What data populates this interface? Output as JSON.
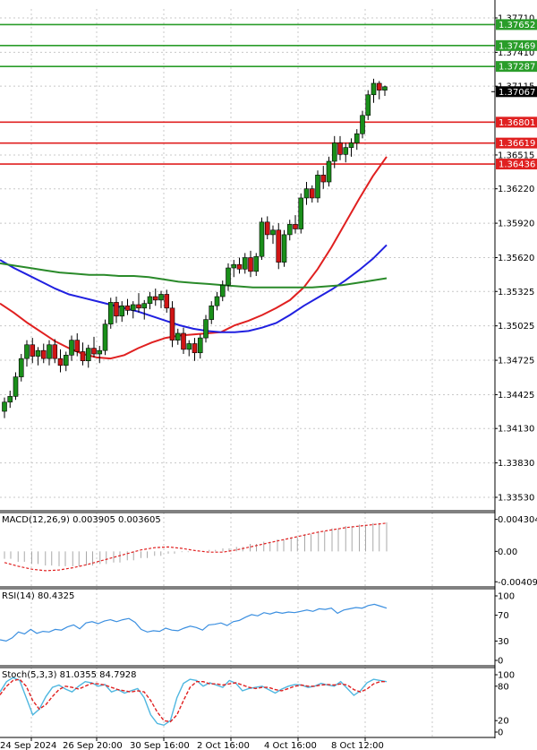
{
  "chart_data": [
    {
      "panel": "price",
      "type": "candlestick",
      "y_ticks": [
        "1.37710",
        "1.37410",
        "1.37115",
        "1.36515",
        "1.36220",
        "1.35920",
        "1.35620",
        "1.35325",
        "1.35025",
        "1.34725",
        "1.34425",
        "1.34130",
        "1.33830",
        "1.33530"
      ],
      "ylim": [
        1.334,
        1.3775
      ],
      "current_price": {
        "value": 1.37067,
        "label": "1.37067"
      },
      "resistance_levels": [
        {
          "value": 1.37652,
          "label": "1.37652",
          "color": "#2a9d2a"
        },
        {
          "value": 1.37469,
          "label": "1.37469",
          "color": "#2a9d2a"
        },
        {
          "value": 1.37287,
          "label": "1.37287",
          "color": "#2a9d2a"
        }
      ],
      "support_levels": [
        {
          "value": 1.36801,
          "label": "1.36801",
          "color": "#e02020"
        },
        {
          "value": 1.36619,
          "label": "1.36619",
          "color": "#e02020"
        },
        {
          "value": 1.36436,
          "label": "1.36436",
          "color": "#e02020"
        }
      ],
      "candle_colors": {
        "up": "#1a8f1a",
        "down": "#d01515"
      },
      "candles": [
        [
          1.3428,
          1.344,
          1.3422,
          1.3436
        ],
        [
          1.3436,
          1.3446,
          1.3431,
          1.3441
        ],
        [
          1.3441,
          1.3462,
          1.3438,
          1.3458
        ],
        [
          1.3458,
          1.3478,
          1.3454,
          1.3474
        ],
        [
          1.3474,
          1.349,
          1.3467,
          1.3486
        ],
        [
          1.3486,
          1.3492,
          1.347,
          1.3476
        ],
        [
          1.3476,
          1.3484,
          1.3468,
          1.3481
        ],
        [
          1.3481,
          1.3487,
          1.347,
          1.3474
        ],
        [
          1.3474,
          1.349,
          1.3468,
          1.3486
        ],
        [
          1.3486,
          1.3491,
          1.347,
          1.3474
        ],
        [
          1.3474,
          1.3482,
          1.3462,
          1.3468
        ],
        [
          1.3468,
          1.348,
          1.3463,
          1.3477
        ],
        [
          1.3477,
          1.3494,
          1.3472,
          1.349
        ],
        [
          1.349,
          1.3496,
          1.3476,
          1.348
        ],
        [
          1.348,
          1.3488,
          1.3468,
          1.3472
        ],
        [
          1.3472,
          1.3486,
          1.3466,
          1.3483
        ],
        [
          1.3483,
          1.3493,
          1.3475,
          1.3478
        ],
        [
          1.3478,
          1.3485,
          1.347,
          1.3481
        ],
        [
          1.3481,
          1.3508,
          1.3477,
          1.3504
        ],
        [
          1.3504,
          1.3527,
          1.35,
          1.3523
        ],
        [
          1.3523,
          1.3528,
          1.3505,
          1.3511
        ],
        [
          1.3511,
          1.3524,
          1.3506,
          1.352
        ],
        [
          1.352,
          1.3526,
          1.3512,
          1.3516
        ],
        [
          1.3516,
          1.3524,
          1.3509,
          1.3521
        ],
        [
          1.3521,
          1.3531,
          1.3514,
          1.3518
        ],
        [
          1.3518,
          1.3525,
          1.3508,
          1.3522
        ],
        [
          1.3522,
          1.3532,
          1.3517,
          1.3528
        ],
        [
          1.3528,
          1.3535,
          1.352,
          1.3525
        ],
        [
          1.3525,
          1.3533,
          1.3518,
          1.353
        ],
        [
          1.353,
          1.3534,
          1.3514,
          1.3518
        ],
        [
          1.3518,
          1.3524,
          1.3484,
          1.349
        ],
        [
          1.349,
          1.35,
          1.3486,
          1.3496
        ],
        [
          1.3496,
          1.3501,
          1.3478,
          1.3482
        ],
        [
          1.3482,
          1.349,
          1.3476,
          1.3487
        ],
        [
          1.3487,
          1.3492,
          1.3472,
          1.3479
        ],
        [
          1.3479,
          1.3495,
          1.3474,
          1.3492
        ],
        [
          1.3492,
          1.3512,
          1.3488,
          1.3508
        ],
        [
          1.3508,
          1.3524,
          1.3504,
          1.352
        ],
        [
          1.352,
          1.3532,
          1.3516,
          1.3528
        ],
        [
          1.3528,
          1.3542,
          1.3524,
          1.3538
        ],
        [
          1.3538,
          1.3557,
          1.3533,
          1.3553
        ],
        [
          1.3553,
          1.356,
          1.3545,
          1.3556
        ],
        [
          1.3556,
          1.3562,
          1.3548,
          1.3552
        ],
        [
          1.3552,
          1.3566,
          1.3548,
          1.3562
        ],
        [
          1.3562,
          1.3568,
          1.3545,
          1.355
        ],
        [
          1.355,
          1.3566,
          1.3546,
          1.3563
        ],
        [
          1.3563,
          1.3597,
          1.356,
          1.3593
        ],
        [
          1.3593,
          1.3598,
          1.3578,
          1.3582
        ],
        [
          1.3582,
          1.359,
          1.3574,
          1.3586
        ],
        [
          1.3586,
          1.3592,
          1.3552,
          1.3558
        ],
        [
          1.3558,
          1.3586,
          1.3554,
          1.3582
        ],
        [
          1.3582,
          1.3595,
          1.3577,
          1.3591
        ],
        [
          1.3591,
          1.3599,
          1.3583,
          1.3587
        ],
        [
          1.3587,
          1.3618,
          1.3583,
          1.3614
        ],
        [
          1.3614,
          1.3628,
          1.3608,
          1.3622
        ],
        [
          1.3622,
          1.3625,
          1.361,
          1.3614
        ],
        [
          1.3614,
          1.3638,
          1.361,
          1.3634
        ],
        [
          1.3634,
          1.3642,
          1.3622,
          1.3628
        ],
        [
          1.3628,
          1.365,
          1.3624,
          1.3646
        ],
        [
          1.3646,
          1.3668,
          1.364,
          1.3662
        ],
        [
          1.3662,
          1.3668,
          1.3647,
          1.3652
        ],
        [
          1.3652,
          1.3662,
          1.3645,
          1.3658
        ],
        [
          1.3658,
          1.3666,
          1.365,
          1.3662
        ],
        [
          1.3662,
          1.3674,
          1.3656,
          1.367
        ],
        [
          1.367,
          1.369,
          1.3666,
          1.3686
        ],
        [
          1.3686,
          1.3708,
          1.3682,
          1.3704
        ],
        [
          1.3704,
          1.3718,
          1.3697,
          1.3714
        ],
        [
          1.3714,
          1.3716,
          1.37,
          1.3708
        ],
        [
          1.3708,
          1.3712,
          1.3703,
          1.3711
        ]
      ],
      "ma_lines": [
        {
          "color": "#e02020",
          "values": [
            1.3522,
            1.3514,
            1.3505,
            1.3497,
            1.3489,
            1.3483,
            1.3478,
            1.3475,
            1.3474,
            1.3477,
            1.3483,
            1.3488,
            1.3492,
            1.3494,
            1.3495,
            1.3496,
            1.3497,
            1.3503,
            1.3507,
            1.3512,
            1.3518,
            1.3525,
            1.3536,
            1.3552,
            1.3571,
            1.3592,
            1.3613,
            1.3633,
            1.365
          ]
        },
        {
          "color": "#2020e0",
          "values": [
            1.356,
            1.3553,
            1.3547,
            1.3541,
            1.3535,
            1.353,
            1.3527,
            1.3524,
            1.3521,
            1.3518,
            1.3515,
            1.3511,
            1.3507,
            1.3503,
            1.35,
            1.3498,
            1.3497,
            1.3497,
            1.3498,
            1.3501,
            1.3505,
            1.3512,
            1.352,
            1.3527,
            1.3534,
            1.3542,
            1.3551,
            1.3561,
            1.3573
          ]
        },
        {
          "color": "#2a8a2a",
          "values": [
            1.3557,
            1.3555,
            1.3553,
            1.3551,
            1.3549,
            1.3548,
            1.3547,
            1.3547,
            1.3546,
            1.3546,
            1.3545,
            1.3543,
            1.3541,
            1.354,
            1.3539,
            1.3538,
            1.3537,
            1.3536,
            1.3536,
            1.3536,
            1.3536,
            1.3536,
            1.3537,
            1.3538,
            1.354,
            1.3542,
            1.3544
          ]
        }
      ],
      "x_labels": [
        "24 Sep 2024",
        "26 Sep 20:00",
        "30 Sep 16:00",
        "2 Oct 16:00",
        "4 Oct 16:00",
        "8 Oct 12:00"
      ],
      "grid": true
    },
    {
      "panel": "macd",
      "type": "histogram+line",
      "label": "MACD(12,26,9) 0.003905 0.003605",
      "y_ticks": [
        "0.004304",
        "0.00",
        "-0.004091"
      ],
      "ylim": [
        -0.0043,
        0.0045
      ],
      "histogram": [
        -0.001,
        -0.0014,
        -0.0017,
        -0.0019,
        -0.002,
        -0.002,
        -0.0019,
        -0.0017,
        -0.0015,
        -0.0012,
        -0.0009,
        -0.0006,
        -0.0003,
        -0.0001,
        0.0,
        0.0002,
        0.0004,
        0.0006,
        0.001,
        0.0013,
        0.0016,
        0.0019,
        0.0023,
        0.0027,
        0.0031,
        0.0034,
        0.0036,
        0.0038,
        0.0039
      ],
      "signal": [
        -0.0015,
        -0.002,
        -0.0024,
        -0.0026,
        -0.0025,
        -0.0022,
        -0.0018,
        -0.0013,
        -0.0008,
        -0.0003,
        0.0002,
        0.0005,
        0.0006,
        0.0004,
        0.0001,
        -0.0001,
        -0.0001,
        0.0002,
        0.0006,
        0.001,
        0.0014,
        0.0018,
        0.0022,
        0.0026,
        0.0029,
        0.0032,
        0.0034,
        0.0036,
        0.0038
      ],
      "signal_color": "#e02020",
      "hist_color": "#a8a8a8"
    },
    {
      "panel": "rsi",
      "type": "line",
      "label": "RSI(14) 80.4325",
      "y_ticks": [
        "100",
        "70",
        "30",
        "0"
      ],
      "ylim": [
        0,
        100
      ],
      "values": [
        32,
        30,
        35,
        44,
        41,
        48,
        42,
        45,
        44,
        48,
        47,
        52,
        55,
        49,
        58,
        60,
        57,
        61,
        63,
        60,
        63,
        65,
        59,
        48,
        44,
        46,
        45,
        50,
        47,
        46,
        50,
        53,
        51,
        47,
        55,
        56,
        58,
        54,
        60,
        62,
        67,
        71,
        69,
        74,
        72,
        75,
        73,
        75,
        74,
        76,
        78,
        76,
        80,
        79,
        81,
        73,
        78,
        80,
        82,
        81,
        85,
        87,
        84,
        81
      ],
      "color": "#3b8fe0"
    },
    {
      "panel": "stoch",
      "type": "line",
      "label": "Stoch(5,3,3) 81.0355 84.7928",
      "y_ticks": [
        "100",
        "80",
        "20",
        "0"
      ],
      "ylim": [
        0,
        100
      ],
      "k": [
        70,
        88,
        95,
        90,
        60,
        30,
        40,
        62,
        78,
        82,
        75,
        70,
        80,
        88,
        86,
        80,
        83,
        70,
        74,
        68,
        72,
        76,
        60,
        30,
        15,
        12,
        20,
        60,
        85,
        92,
        90,
        80,
        86,
        82,
        78,
        90,
        85,
        72,
        76,
        78,
        80,
        74,
        68,
        75,
        80,
        83,
        82,
        78,
        80,
        85,
        82,
        80,
        88,
        76,
        64,
        72,
        86,
        92,
        90,
        88
      ],
      "d": [
        65,
        80,
        90,
        92,
        80,
        55,
        40,
        48,
        62,
        74,
        80,
        78,
        75,
        80,
        85,
        84,
        82,
        78,
        74,
        72,
        70,
        72,
        70,
        55,
        35,
        20,
        18,
        30,
        55,
        78,
        88,
        88,
        84,
        84,
        82,
        84,
        86,
        82,
        78,
        76,
        78,
        78,
        74,
        72,
        76,
        80,
        82,
        80,
        80,
        82,
        83,
        82,
        84,
        82,
        74,
        70,
        75,
        84,
        88,
        88
      ],
      "k_color": "#4fb7e0",
      "d_color": "#e02020"
    }
  ]
}
